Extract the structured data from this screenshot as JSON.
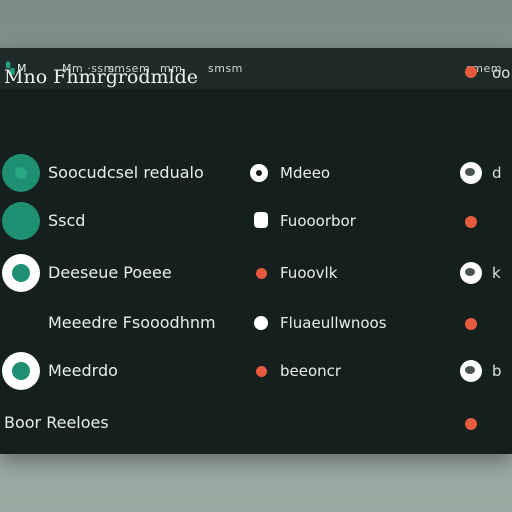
{
  "topbar": {
    "app_label": "M",
    "items": [
      "Mm ·ssm",
      "smsem",
      "mm",
      "smsm"
    ],
    "right": "smem"
  },
  "header": {
    "title": "Mno Fhmrgrodmlde",
    "right_label": "oo"
  },
  "rows": [
    {
      "name": "Soocudcsel redualo",
      "mid_label": "Mdeeo",
      "right_label": "d"
    },
    {
      "name": "Sscd",
      "mid_label": "Fuooorbor",
      "right_label": ""
    },
    {
      "name": "Deeseue Poeee",
      "mid_label": "Fuoovlk",
      "right_label": "k"
    },
    {
      "name": "Meeedre Fsooodhnm",
      "mid_label": "Fluaeullwnoos",
      "right_label": ""
    },
    {
      "name": "Meedrdo",
      "mid_label": "beeoncr",
      "right_label": "b"
    },
    {
      "name": "Boor Reeloes",
      "mid_label": "",
      "right_label": ""
    }
  ],
  "colors": {
    "accent": "#1f8f72",
    "status_red": "#e65a3e",
    "panel": "#15201e"
  }
}
